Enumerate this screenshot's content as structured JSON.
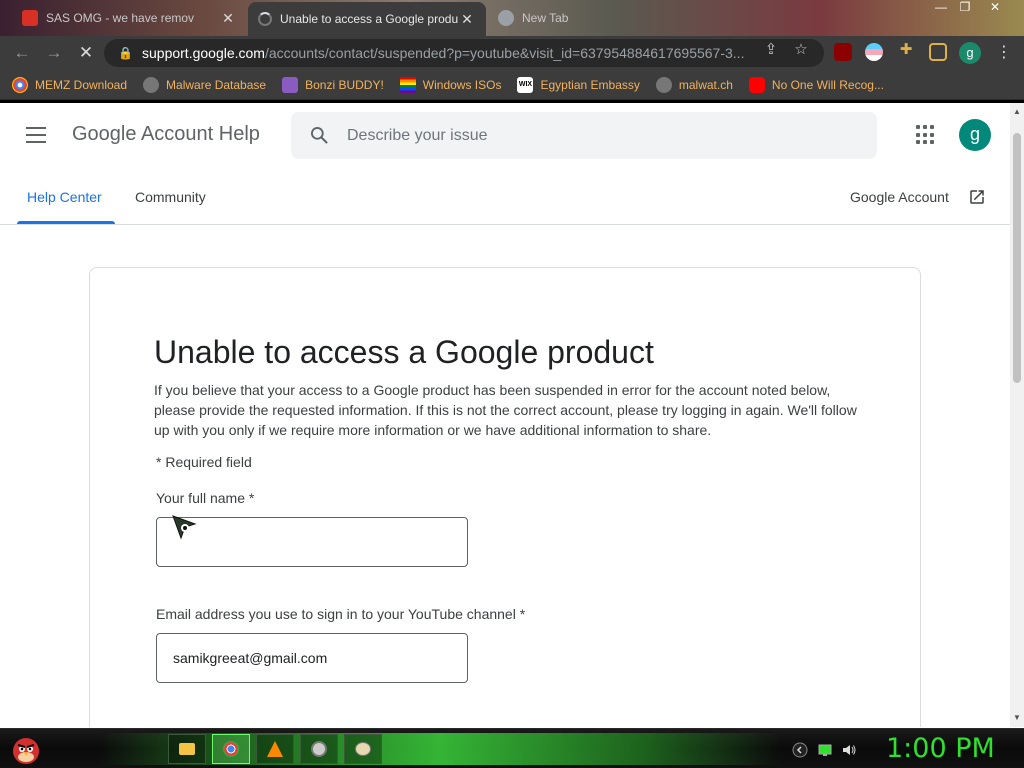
{
  "browser": {
    "tabs": [
      {
        "title": "SAS OMG - we have remov",
        "active": false
      },
      {
        "title": "Unable to access a Google produ",
        "active": true
      },
      {
        "title": "New Tab",
        "active": false
      }
    ],
    "url_host": "support.google.com",
    "url_path": "/accounts/contact/suspended?p=youtube&visit_id=637954884617695567-3...",
    "profile_initial": "g",
    "bookmarks": [
      {
        "label": "MEMZ Download",
        "icon": "chrome-icon"
      },
      {
        "label": "Malware Database",
        "icon": "globe-icon"
      },
      {
        "label": "Bonzi BUDDY!",
        "icon": "bonzi-icon"
      },
      {
        "label": "Windows ISOs",
        "icon": "rainbow-flag-icon"
      },
      {
        "label": "Egyptian Embassy",
        "icon": "wix-icon"
      },
      {
        "label": "malwat.ch",
        "icon": "globe-icon"
      },
      {
        "label": "No One Will Recog...",
        "icon": "youtube-icon"
      }
    ]
  },
  "header": {
    "title": "Google Account Help",
    "search_placeholder": "Describe your issue",
    "avatar_initial": "g"
  },
  "subnav": {
    "help_center": "Help Center",
    "community": "Community",
    "google_account": "Google Account"
  },
  "form": {
    "title": "Unable to access a Google product",
    "intro": "If you believe that your access to a Google product has been suspended in error for the account noted below, please provide the requested information. If this is not the correct account, please try logging in again. We'll follow up with you only if we require more information or we have additional information to share.",
    "required_note": "* Required field",
    "full_name_label": "Your full name *",
    "full_name_value": "",
    "email_label": "Email address you use to sign in to your YouTube channel *",
    "email_value": "samikgreeat@gmail.com"
  },
  "taskbar": {
    "clock": "1:00 PM"
  },
  "colors": {
    "accent_blue": "#1a73e8",
    "avatar_green": "#00897b",
    "bookmark_text": "#f3b25c",
    "clock_green": "#2fe02f"
  }
}
